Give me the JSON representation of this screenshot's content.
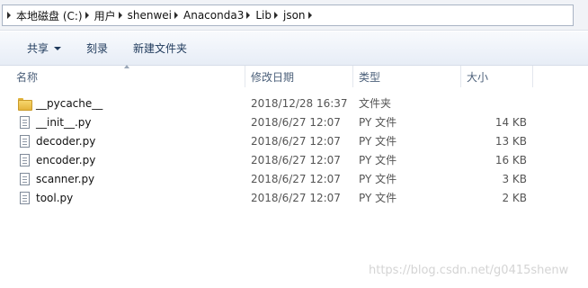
{
  "breadcrumb": [
    "本地磁盘 (C:)",
    "用户",
    "shenwei",
    "Anaconda3",
    "Lib",
    "json"
  ],
  "toolbar": {
    "share_label": "共享",
    "burn_label": "刻录",
    "new_folder_label": "新建文件夹"
  },
  "columns": {
    "name": "名称",
    "date": "修改日期",
    "type": "类型",
    "size": "大小"
  },
  "files": [
    {
      "name": "__pycache__",
      "date": "2018/12/28 16:37",
      "type": "文件夹",
      "size": "",
      "icon": "folder-icon"
    },
    {
      "name": "__init__.py",
      "date": "2018/6/27 12:07",
      "type": "PY 文件",
      "size": "14 KB",
      "icon": "file-icon"
    },
    {
      "name": "decoder.py",
      "date": "2018/6/27 12:07",
      "type": "PY 文件",
      "size": "13 KB",
      "icon": "file-icon"
    },
    {
      "name": "encoder.py",
      "date": "2018/6/27 12:07",
      "type": "PY 文件",
      "size": "16 KB",
      "icon": "file-icon"
    },
    {
      "name": "scanner.py",
      "date": "2018/6/27 12:07",
      "type": "PY 文件",
      "size": "3 KB",
      "icon": "file-icon"
    },
    {
      "name": "tool.py",
      "date": "2018/6/27 12:07",
      "type": "PY 文件",
      "size": "2 KB",
      "icon": "file-icon"
    }
  ],
  "watermark": "https://blog.csdn.net/g0415shenw"
}
